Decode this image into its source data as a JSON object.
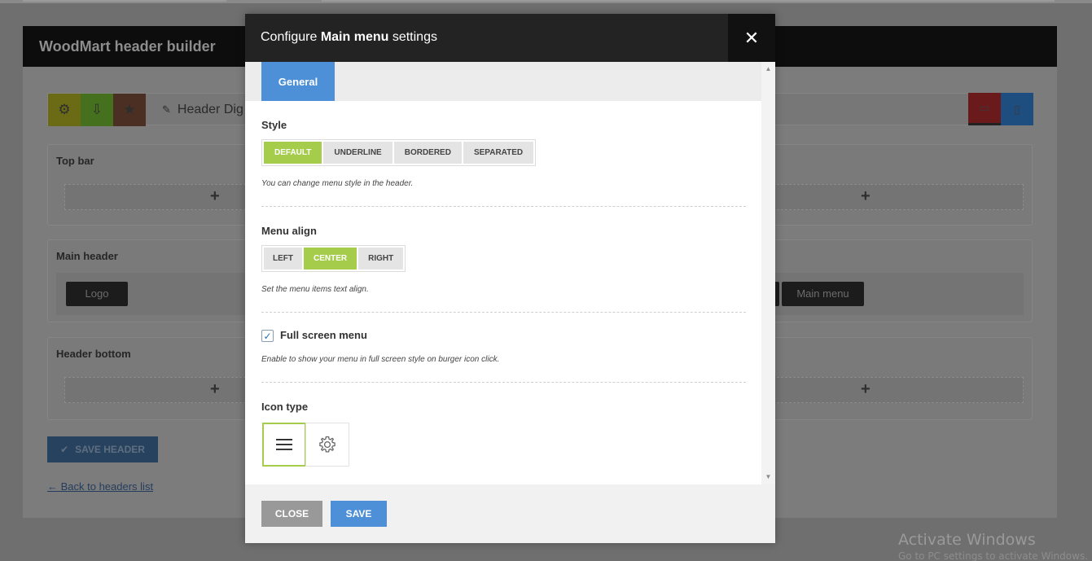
{
  "background": {
    "builder_title": "WoodMart header builder",
    "header_name": "Header Dig",
    "rows": [
      {
        "title": "Top bar"
      },
      {
        "title": "Main header",
        "chips": [
          "Logo",
          "Main menu"
        ]
      },
      {
        "title": "Header bottom"
      }
    ],
    "plus_symbol": "+",
    "save_header_label": "SAVE HEADER",
    "back_link": "← Back to headers list"
  },
  "modal": {
    "title_prefix": "Configure ",
    "title_bold": "Main menu",
    "title_suffix": " settings",
    "close_symbol": "✕",
    "tabs": [
      {
        "label": "General",
        "active": true
      }
    ],
    "style": {
      "title": "Style",
      "options": [
        "DEFAULT",
        "UNDERLINE",
        "BORDERED",
        "SEPARATED"
      ],
      "selected": "DEFAULT",
      "description": "You can change menu style in the header."
    },
    "menu_align": {
      "title": "Menu align",
      "options": [
        "LEFT",
        "CENTER",
        "RIGHT"
      ],
      "selected": "CENTER",
      "description": "Set the menu items text align."
    },
    "full_screen": {
      "label": "Full screen menu",
      "checked": true,
      "description": "Enable to show your menu in full screen style on burger icon click."
    },
    "icon_type": {
      "title": "Icon type",
      "options": [
        "hamburger-icon",
        "gear-icon"
      ],
      "selected": "hamburger-icon"
    },
    "footer": {
      "close_label": "CLOSE",
      "save_label": "SAVE"
    }
  },
  "watermark": {
    "title": "Activate Windows",
    "subtitle": "Go to PC settings to activate Windows."
  },
  "colors": {
    "accent_green": "#a5cd4b",
    "accent_blue": "#4d90d7",
    "modal_header": "#232323"
  }
}
